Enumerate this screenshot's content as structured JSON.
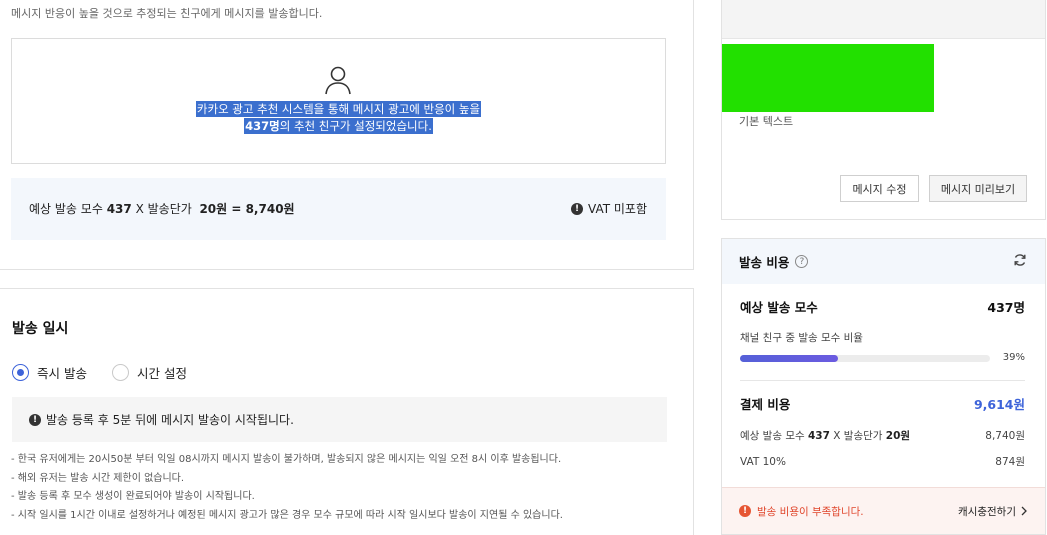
{
  "message": {
    "description": "메시지 반응이 높을 것으로 추정되는 친구에게 메시지를 발송합니다.",
    "recommend_line1": "카카오 광고 추천 시스템을 통해 메시지 광고에 반응이 높을",
    "recommend_count": "437명",
    "recommend_line2_suffix": "의 추천 친구가 설정되었습니다.",
    "estimate_prefix": "예상 발송 모수",
    "estimate_count": "437",
    "estimate_mid": "X 발송단가",
    "estimate_price": "20원 = 8,740원",
    "vat_note": "VAT 미포함"
  },
  "schedule": {
    "title": "발송 일시",
    "options": [
      {
        "label": "즉시 발송",
        "selected": true
      },
      {
        "label": "시간 설정",
        "selected": false
      }
    ],
    "notice": "발송 등록 후 5분 뒤에 메시지 발송이 시작됩니다.",
    "rules": [
      "- 한국 유저에게는 20시50분 부터 익일 08시까지 메시지 발송이 불가하며, 발송되지 않은 메시지는 익일 오전 8시 이후 발송됩니다.",
      "- 해외 유저는 발송 시간 제한이 없습니다.",
      "- 발송 등록 후 모수 생성이 완료되어야 발송이 시작됩니다.",
      "- 시작 일시를 1시간 이내로 설정하거나 예정된 메시지 광고가 많은 경우 모수 규모에 따라 시작 일시보다 발송이 지연될 수 있습니다."
    ]
  },
  "preview": {
    "image_color": "#22e000",
    "text": "기본 텍스트",
    "edit_button": "메시지 수정",
    "preview_button": "메시지 미리보기"
  },
  "cost": {
    "title": "발송 비용",
    "help_icon": "question-circle-icon",
    "refresh_icon": "refresh-icon",
    "expected_label": "예상 발송 모수",
    "expected_value": "437명",
    "ratio_label": "채널 친구 중 발송 모수 비율",
    "ratio_percent": 39,
    "ratio_text": "39%",
    "payment_label": "결제 비용",
    "payment_value": "9,614원",
    "detail_prefix": "예상 발송 모수",
    "detail_count": "437",
    "detail_mid": "X 발송단가",
    "detail_price": "20원",
    "detail_value": "8,740원",
    "vat_label": "VAT 10%",
    "vat_value": "874원",
    "warning": "발송 비용이 부족합니다.",
    "charge_link": "캐시충전하기",
    "accent_color": "#3d63d9",
    "warning_color": "#e0452b"
  }
}
